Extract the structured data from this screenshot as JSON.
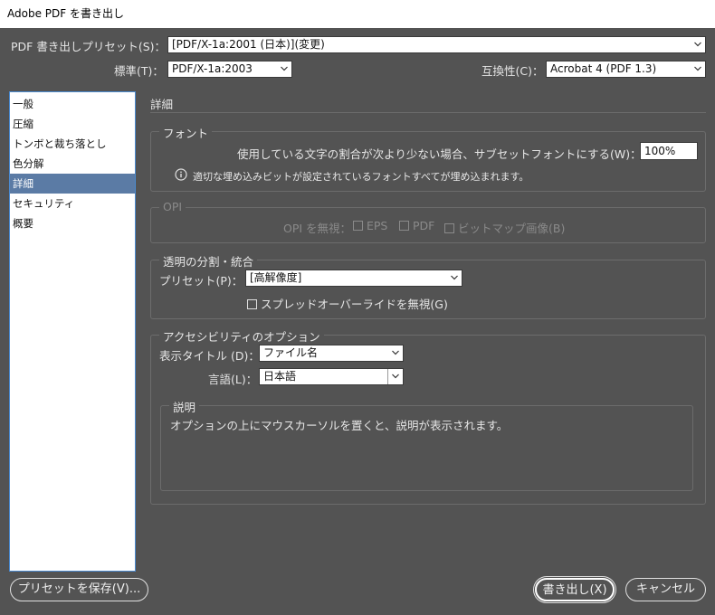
{
  "window": {
    "title": "Adobe PDF を書き出し"
  },
  "header": {
    "preset_label": "PDF 書き出しプリセット(S)：",
    "preset_value": "[PDF/X-1a:2001 (日本)](変更)",
    "standard_label": "標準(T)：",
    "standard_value": "PDF/X-1a:2003",
    "compat_label": "互換性(C)：",
    "compat_value": "Acrobat 4 (PDF 1.3)"
  },
  "sidebar": {
    "items": [
      {
        "label": "一般"
      },
      {
        "label": "圧縮"
      },
      {
        "label": "トンボと裁ち落とし"
      },
      {
        "label": "色分解"
      },
      {
        "label": "詳細",
        "selected": true
      },
      {
        "label": "セキュリティ"
      },
      {
        "label": "概要"
      }
    ]
  },
  "panel": {
    "heading": "詳細",
    "font": {
      "legend": "フォント",
      "subset_label": "使用している文字の割合が次より少ない場合、サブセットフォントにする(W)：",
      "subset_value": "100%",
      "info_text": "適切な埋め込みビットが設定されているフォントすべてが埋め込まれます。"
    },
    "opi": {
      "legend": "OPI",
      "ignore_label": "OPI を無視：",
      "eps": "EPS",
      "pdf": "PDF",
      "bitmap": "ビットマップ画像(B)"
    },
    "transparency": {
      "legend": "透明の分割・統合",
      "preset_label": "プリセット(P)：",
      "preset_value": "[高解像度]",
      "spread_label": "スプレッドオーバーライドを無視(G)"
    },
    "accessibility": {
      "legend": "アクセシビリティのオプション",
      "title_label": "表示タイトル (D)：",
      "title_value": "ファイル名",
      "lang_label": "言語(L)：",
      "lang_value": "日本語"
    },
    "description": {
      "legend": "説明",
      "text": "オプションの上にマウスカーソルを置くと、説明が表示されます。"
    }
  },
  "footer": {
    "save_preset": "プリセットを保存(V)...",
    "export": "書き出し(X)",
    "cancel": "キャンセル"
  }
}
